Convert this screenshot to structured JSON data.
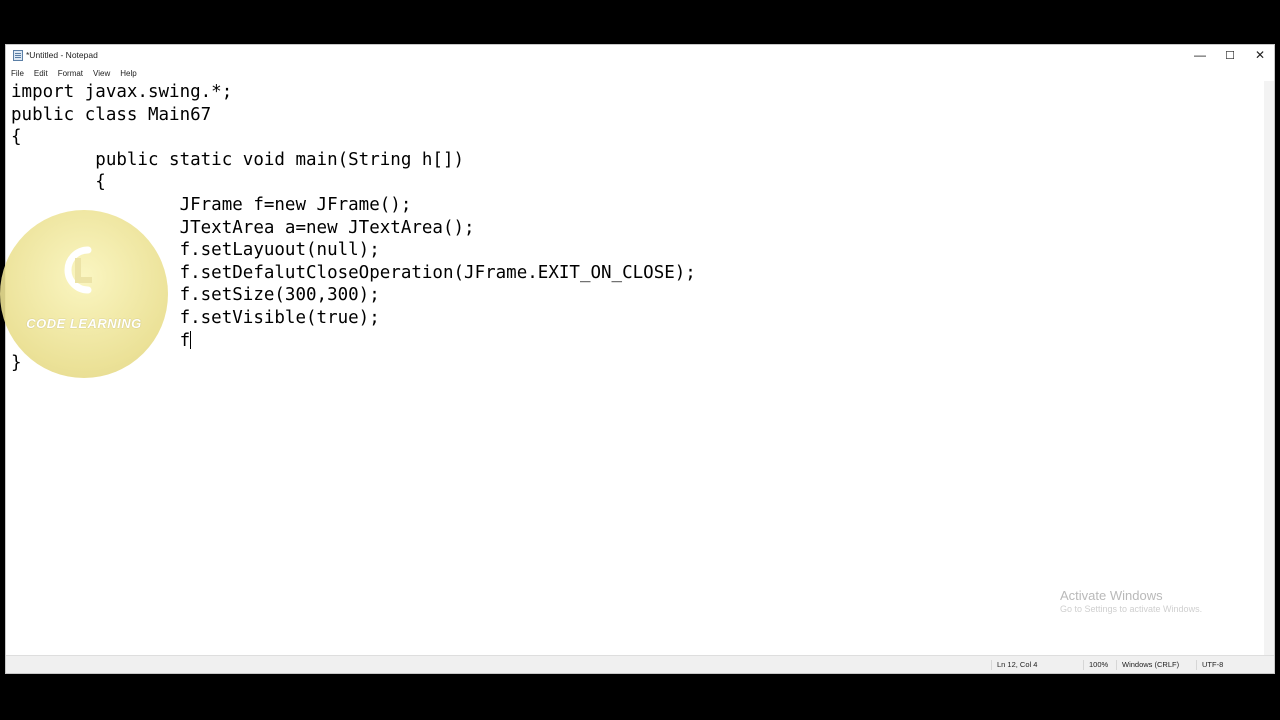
{
  "window": {
    "title": "*Untitled - Notepad",
    "icon": "notepad-icon",
    "controls": {
      "minimize": "—",
      "maximize": "☐",
      "close": "✕"
    }
  },
  "menu": [
    "File",
    "Edit",
    "Format",
    "View",
    "Help"
  ],
  "editor": {
    "lines": [
      "import javax.swing.*;",
      "public class Main67",
      "{",
      "        public static void main(String h[])",
      "        {",
      "                JFrame f=new JFrame();",
      "                JTextArea a=new JTextArea();",
      "                f.setLayuout(null);",
      "                f.setDefalutCloseOperation(JFrame.EXIT_ON_CLOSE);",
      "                f.setSize(300,300);",
      "                f.setVisible(true);",
      "                f",
      "}"
    ]
  },
  "statusbar": {
    "position": "Ln 12, Col 4",
    "zoom": "100%",
    "line_ending": "Windows (CRLF)",
    "encoding": "UTF-8"
  },
  "watermark": {
    "text": "CODE LEARNING"
  },
  "overlay": {
    "activate_title": "Activate Windows",
    "activate_sub": "Go to Settings to activate Windows."
  }
}
